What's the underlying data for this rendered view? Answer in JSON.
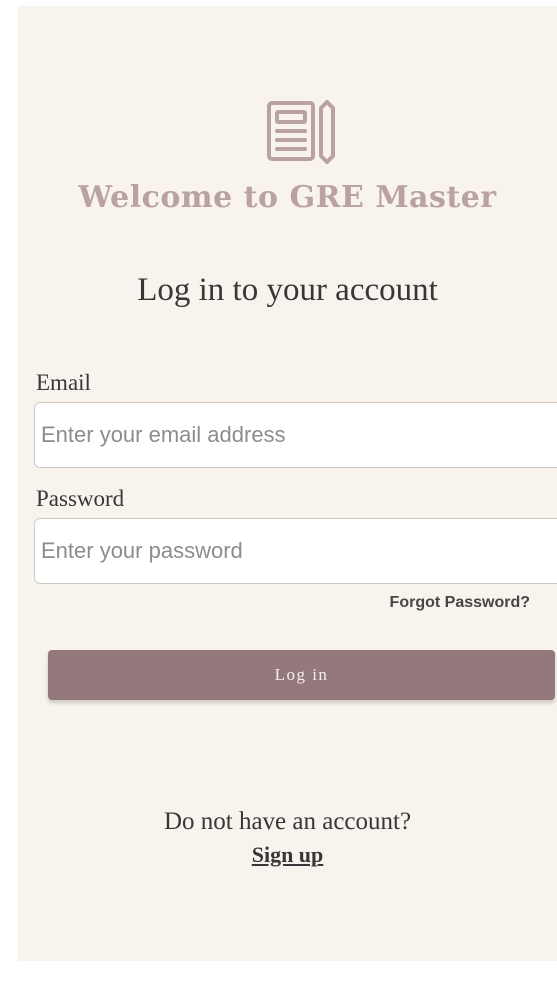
{
  "header": {
    "logo_icon": "newspaper-pencil-icon",
    "welcome_title": "Welcome to GRE Master",
    "subtitle": "Log in to your account"
  },
  "form": {
    "email_label": "Email",
    "email_placeholder": "Enter your email address",
    "email_value": "",
    "password_label": "Password",
    "password_placeholder": "Enter your password",
    "password_value": "",
    "forgot_password": "Forgot Password?",
    "login_button": "Log in"
  },
  "footer": {
    "no_account_text": "Do not have an account?",
    "signup_link": "Sign up"
  },
  "colors": {
    "background": "#f8f3ec",
    "accent": "#93797b",
    "title": "#b9a29f",
    "text": "#3a3536"
  }
}
